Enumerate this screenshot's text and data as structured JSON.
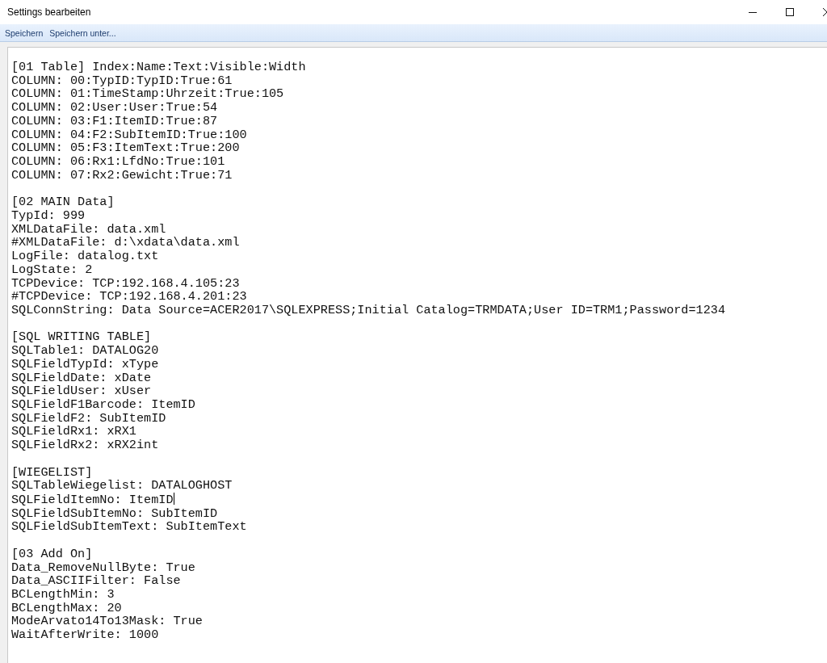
{
  "window": {
    "title": "Settings bearbeiten"
  },
  "toolbar": {
    "items": [
      "Speichern",
      "Speichern unter..."
    ]
  },
  "editor": {
    "sections": [
      {
        "lines": [
          {
            "text": "[01 Table] Index:Name:Text:Visible:Width",
            "caret": false
          },
          {
            "text": "COLUMN: 00:TypID:TypID:True:61",
            "caret": false
          },
          {
            "text": "COLUMN: 01:TimeStamp:Uhrzeit:True:105",
            "caret": false
          },
          {
            "text": "COLUMN: 02:User:User:True:54",
            "caret": false
          },
          {
            "text": "COLUMN: 03:F1:ItemID:True:87",
            "caret": false
          },
          {
            "text": "COLUMN: 04:F2:SubItemID:True:100",
            "caret": false
          },
          {
            "text": "COLUMN: 05:F3:ItemText:True:200",
            "caret": false
          },
          {
            "text": "COLUMN: 06:Rx1:LfdNo:True:101",
            "caret": false
          },
          {
            "text": "COLUMN: 07:Rx2:Gewicht:True:71",
            "caret": false
          }
        ]
      },
      {
        "lines": [
          {
            "text": "[02 MAIN Data]",
            "caret": false
          },
          {
            "text": "TypId: 999",
            "caret": false
          },
          {
            "text": "XMLDataFile: data.xml",
            "caret": false
          },
          {
            "text": "#XMLDataFile: d:\\xdata\\data.xml",
            "caret": false
          },
          {
            "text": "LogFile: datalog.txt",
            "caret": false
          },
          {
            "text": "LogState: 2",
            "caret": false
          },
          {
            "text": "TCPDevice: TCP:192.168.4.105:23",
            "caret": false
          },
          {
            "text": "#TCPDevice: TCP:192.168.4.201:23",
            "caret": false
          },
          {
            "text": "SQLConnString: Data Source=ACER2017\\SQLEXPRESS;Initial Catalog=TRMDATA;User ID=TRM1;Password=1234",
            "caret": false
          }
        ]
      },
      {
        "lines": [
          {
            "text": "[SQL WRITING TABLE]",
            "caret": false
          },
          {
            "text": "SQLTable1: DATALOG20",
            "caret": false
          },
          {
            "text": "SQLFieldTypId: xType",
            "caret": false
          },
          {
            "text": "SQLFieldDate: xDate",
            "caret": false
          },
          {
            "text": "SQLFieldUser: xUser",
            "caret": false
          },
          {
            "text": "SQLFieldF1Barcode: ItemID",
            "caret": false
          },
          {
            "text": "SQLFieldF2: SubItemID",
            "caret": false
          },
          {
            "text": "SQLFieldRx1: xRX1",
            "caret": false
          },
          {
            "text": "SQLFieldRx2: xRX2int",
            "caret": false
          }
        ]
      },
      {
        "lines": [
          {
            "text": "[WIEGELIST]",
            "caret": false
          },
          {
            "text": "SQLTableWiegelist: DATALOGHOST",
            "caret": false
          },
          {
            "text": "SQLFieldItemNo: ItemID",
            "caret": true
          },
          {
            "text": "SQLFieldSubItemNo: SubItemID",
            "caret": false
          },
          {
            "text": "SQLFieldSubItemText: SubItemText",
            "caret": false
          }
        ]
      },
      {
        "lines": [
          {
            "text": "[03 Add On]",
            "caret": false
          },
          {
            "text": "Data_RemoveNullByte: True",
            "caret": false
          },
          {
            "text": "Data_ASCIIFilter: False",
            "caret": false
          },
          {
            "text": "BCLengthMin: 3",
            "caret": false
          },
          {
            "text": "BCLengthMax: 20",
            "caret": false
          },
          {
            "text": "ModeArvato14To13Mask: True",
            "caret": false
          },
          {
            "text": "WaitAfterWrite: 1000",
            "caret": false
          }
        ]
      }
    ]
  }
}
